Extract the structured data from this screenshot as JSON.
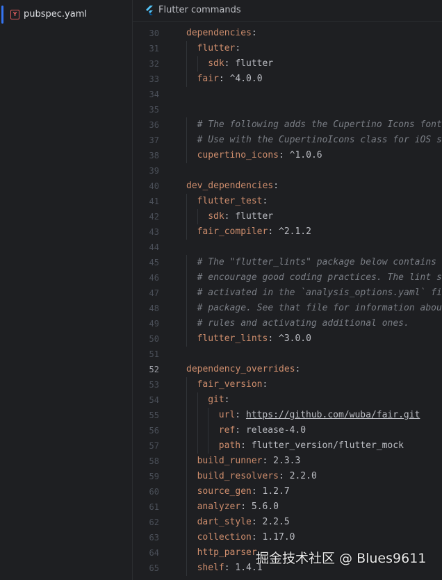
{
  "sidebar": {
    "file_icon_letter": "Y",
    "file_name": "pubspec.yaml"
  },
  "notice": {
    "icon": "flutter-icon",
    "text": "Flutter commands"
  },
  "colors": {
    "key": "#cf8e6d",
    "comment": "#7a7e85",
    "text": "#bcbec4",
    "accent": "#3574f0"
  },
  "lines": [
    {
      "n": "30",
      "indent": 0,
      "key": "dependencies",
      "value": "",
      "kind": "kv"
    },
    {
      "n": "31",
      "indent": 1,
      "key": "flutter",
      "value": "",
      "kind": "kv"
    },
    {
      "n": "32",
      "indent": 2,
      "key": "sdk",
      "value": "flutter",
      "kind": "kv"
    },
    {
      "n": "33",
      "indent": 1,
      "key": "fair",
      "value": "^4.0.0",
      "kind": "kv"
    },
    {
      "n": "34",
      "indent": 0,
      "kind": "blank"
    },
    {
      "n": "35",
      "indent": 0,
      "kind": "blank"
    },
    {
      "n": "36",
      "indent": 1,
      "text": "# The following adds the Cupertino Icons font",
      "kind": "comment"
    },
    {
      "n": "37",
      "indent": 1,
      "text": "# Use with the CupertinoIcons class for iOS s",
      "kind": "comment"
    },
    {
      "n": "38",
      "indent": 1,
      "key": "cupertino_icons",
      "value": "^1.0.6",
      "kind": "kv"
    },
    {
      "n": "39",
      "indent": 0,
      "kind": "blank"
    },
    {
      "n": "40",
      "indent": 0,
      "key": "dev_dependencies",
      "value": "",
      "kind": "kv"
    },
    {
      "n": "41",
      "indent": 1,
      "key": "flutter_test",
      "value": "",
      "kind": "kv"
    },
    {
      "n": "42",
      "indent": 2,
      "key": "sdk",
      "value": "flutter",
      "kind": "kv"
    },
    {
      "n": "43",
      "indent": 1,
      "key": "fair_compiler",
      "value": "^2.1.2",
      "kind": "kv"
    },
    {
      "n": "44",
      "indent": 0,
      "kind": "blank"
    },
    {
      "n": "45",
      "indent": 1,
      "text": "# The \"flutter_lints\" package below contains a",
      "kind": "comment"
    },
    {
      "n": "46",
      "indent": 1,
      "text": "# encourage good coding practices. The lint se",
      "kind": "comment"
    },
    {
      "n": "47",
      "indent": 1,
      "text": "# activated in the `analysis_options.yaml` fi",
      "kind": "comment"
    },
    {
      "n": "48",
      "indent": 1,
      "text": "# package. See that file for information abou",
      "kind": "comment"
    },
    {
      "n": "49",
      "indent": 1,
      "text": "# rules and activating additional ones.",
      "kind": "comment"
    },
    {
      "n": "50",
      "indent": 1,
      "key": "flutter_lints",
      "value": "^3.0.0",
      "kind": "kv"
    },
    {
      "n": "51",
      "indent": 0,
      "kind": "blank"
    },
    {
      "n": "52",
      "indent": 0,
      "key": "dependency_overrides",
      "value": "",
      "kind": "kv",
      "current": true
    },
    {
      "n": "53",
      "indent": 1,
      "key": "fair_version",
      "value": "",
      "kind": "kv"
    },
    {
      "n": "54",
      "indent": 2,
      "key": "git",
      "value": "",
      "kind": "kv"
    },
    {
      "n": "55",
      "indent": 3,
      "key": "url",
      "value": "https://github.com/wuba/fair.git",
      "kind": "kv",
      "link": true
    },
    {
      "n": "56",
      "indent": 3,
      "key": "ref",
      "value": "release-4.0",
      "kind": "kv"
    },
    {
      "n": "57",
      "indent": 3,
      "key": "path",
      "value": "flutter_version/flutter_mock",
      "kind": "kv"
    },
    {
      "n": "58",
      "indent": 1,
      "key": "build_runner",
      "value": "2.3.3",
      "kind": "kv"
    },
    {
      "n": "59",
      "indent": 1,
      "key": "build_resolvers",
      "value": "2.2.0",
      "kind": "kv"
    },
    {
      "n": "60",
      "indent": 1,
      "key": "source_gen",
      "value": "1.2.7",
      "kind": "kv"
    },
    {
      "n": "61",
      "indent": 1,
      "key": "analyzer",
      "value": "5.6.0",
      "kind": "kv"
    },
    {
      "n": "62",
      "indent": 1,
      "key": "dart_style",
      "value": "2.2.5",
      "kind": "kv"
    },
    {
      "n": "63",
      "indent": 1,
      "key": "collection",
      "value": "1.17.0",
      "kind": "kv"
    },
    {
      "n": "64",
      "indent": 1,
      "key": "http_parser",
      "value": "",
      "kind": "kv",
      "partial": true
    },
    {
      "n": "65",
      "indent": 1,
      "key": "shelf",
      "value": "1.4.1",
      "kind": "kv"
    }
  ],
  "watermark": "掘金技术社区 @ Blues9611"
}
